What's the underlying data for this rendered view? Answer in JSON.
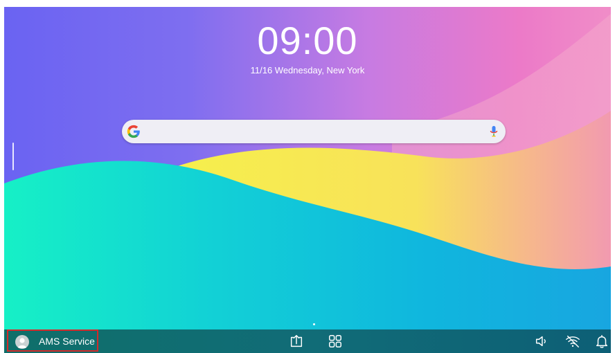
{
  "lockscreen": {
    "time": "09:00",
    "date_location": "11/16 Wednesday, New York"
  },
  "search": {
    "provider_icon": "google-g-icon",
    "mic_icon": "microphone-icon"
  },
  "taskbar": {
    "user_label": "AMS Service",
    "icons": [
      "avatar-icon",
      "screen-share-icon",
      "apps-grid-icon",
      "volume-icon",
      "wifi-off-icon",
      "notification-bell-icon"
    ]
  },
  "colors": {
    "taskbar": "#116c77",
    "highlight_border": "#d32a2a",
    "wave_teal": "#19e6c0",
    "wave_blue": "#12b3dd",
    "wave_yellow": "#f7ea4a"
  }
}
